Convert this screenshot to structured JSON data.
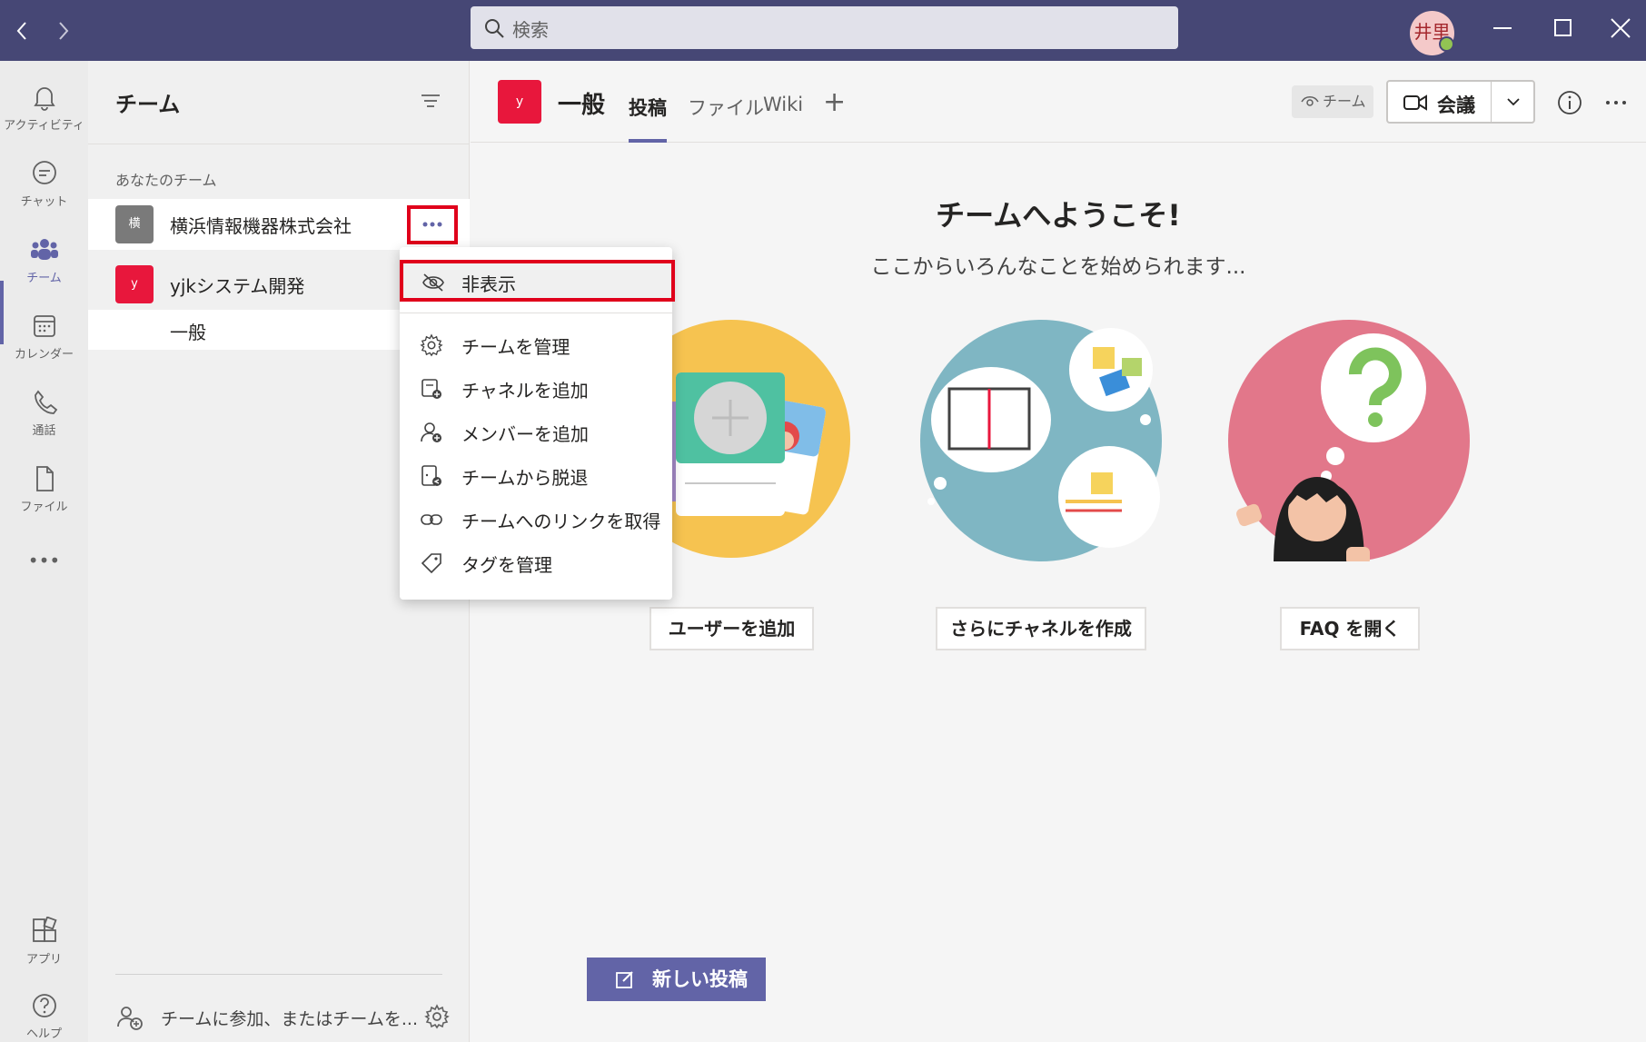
{
  "titlebar": {
    "back_label": "<",
    "forward_label": ">",
    "search_placeholder": "検索",
    "user_initials": "井里"
  },
  "rail": {
    "items": [
      {
        "label": "アクティビティ",
        "icon": "bell-icon"
      },
      {
        "label": "チャット",
        "icon": "chat-icon"
      },
      {
        "label": "チーム",
        "icon": "teams-icon",
        "active": true
      },
      {
        "label": "カレンダー",
        "icon": "calendar-icon"
      },
      {
        "label": "通話",
        "icon": "phone-icon"
      },
      {
        "label": "ファイル",
        "icon": "file-icon"
      }
    ],
    "more_label": "•••",
    "apps_label": "アプリ",
    "help_label": "ヘルプ"
  },
  "panel": {
    "title": "チーム",
    "section_label": "あなたのチーム",
    "teams": [
      {
        "icon_text": "横",
        "name": "横浜情報機器株式会社",
        "color": "#7a7a7a"
      },
      {
        "icon_text": "y",
        "name": "yjkシステム開発",
        "color": "#e8173c"
      }
    ],
    "channel": "一般",
    "join_text": "チームに参加、またはチームを..."
  },
  "main": {
    "channel_icon_text": "y",
    "channel_title": "一般",
    "tabs": [
      "投稿",
      "ファイル",
      "Wiki"
    ],
    "add_tab_label": "+",
    "team_pill": "チーム",
    "meet_label": "会議",
    "welcome_title": "チームへようこそ!",
    "welcome_subtitle": "ここからいろんなことを始められます...",
    "actions": [
      "ユーザーを追加",
      "さらにチャネルを作成",
      "FAQ を開く"
    ],
    "new_post_label": "新しい投稿"
  },
  "menu": {
    "items": [
      {
        "label": "非表示",
        "icon": "hide-eye-icon"
      },
      {
        "label": "チームを管理",
        "icon": "gear-icon"
      },
      {
        "label": "チャネルを追加",
        "icon": "add-channel-icon"
      },
      {
        "label": "メンバーを追加",
        "icon": "add-member-icon"
      },
      {
        "label": "チームから脱退",
        "icon": "leave-team-icon"
      },
      {
        "label": "チームへのリンクを取得",
        "icon": "link-icon"
      },
      {
        "label": "タグを管理",
        "icon": "tag-icon"
      }
    ]
  },
  "colors": {
    "titlebar": "#464775",
    "accent": "#6264a7",
    "highlight_border": "#e0001b"
  }
}
